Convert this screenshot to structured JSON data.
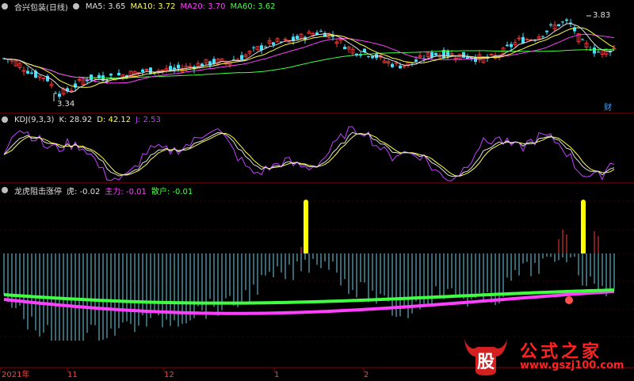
{
  "colors": {
    "bg": "#000000",
    "axis": "#8b0000",
    "up": "#ff3b3b",
    "down": "#40e0ff",
    "ma5": "#e0e0e0",
    "ma10": "#ffff40",
    "ma20": "#ff40ff",
    "ma60": "#40ff40",
    "k": "#e0e0e0",
    "d": "#ffff40",
    "j": "#c040ff",
    "main": "#ff40ff",
    "retail": "#40ff40",
    "spike": "#ffff00"
  },
  "price_panel": {
    "title": "合兴包装(日线)",
    "ma": [
      {
        "label": "MA5: 3.65",
        "color": "#e0e0e0"
      },
      {
        "label": "MA10: 3.72",
        "color": "#ffff40"
      },
      {
        "label": "MA20: 3.70",
        "color": "#ff40ff"
      },
      {
        "label": "MA60: 3.62",
        "color": "#40ff40"
      }
    ],
    "high_label": "3.83",
    "low_label": "3.34",
    "badge": "财"
  },
  "kdj_panel": {
    "title": "KDJ(9,3,3)",
    "items": [
      {
        "label": "K: 28.92",
        "color": "#e0e0e0"
      },
      {
        "label": "D: 42.12",
        "color": "#ffff40"
      },
      {
        "label": "J: 2.53",
        "color": "#c040ff"
      }
    ]
  },
  "ind_panel": {
    "title": "龙虎阻击涨停",
    "items": [
      {
        "label": "虎: -0.02",
        "color": "#e0e0e0"
      },
      {
        "label": "主力: -0.01",
        "color": "#ff40ff"
      },
      {
        "label": "散户: -0.01",
        "color": "#40ff40"
      }
    ]
  },
  "x_axis": {
    "labels": [
      "2021年",
      "11",
      "12",
      "1",
      "2"
    ]
  },
  "watermark": {
    "logo_text": "股",
    "name": "公式之家",
    "url": "www.gszj100.com"
  },
  "chart_data": {
    "type": "candlestick",
    "title": "合兴包装(日线)",
    "annotated_high": 3.83,
    "annotated_low": 3.34,
    "ma_latest": {
      "MA5": 3.65,
      "MA10": 3.72,
      "MA20": 3.7,
      "MA60": 3.62
    },
    "kdj_latest": {
      "K": 28.92,
      "D": 42.12,
      "J": 2.53
    },
    "indicator_latest": {
      "虎": -0.02,
      "主力": -0.01,
      "散户": -0.01
    },
    "x_ticks": [
      "2021年",
      "11",
      "12",
      "1",
      "2"
    ],
    "spike_bars": 2
  }
}
